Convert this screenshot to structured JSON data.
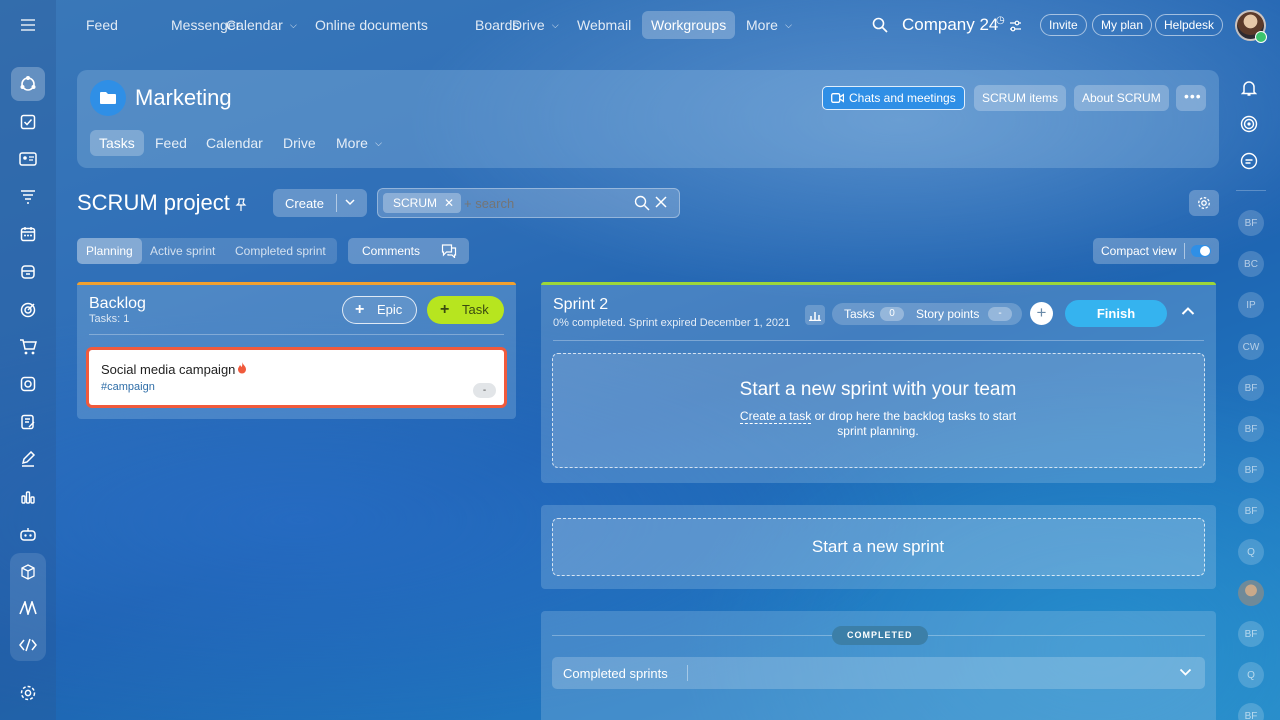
{
  "topnav": {
    "items": [
      "Feed",
      "Messenger",
      "Calendar",
      "Online documents",
      "Boards",
      "Drive",
      "Webmail",
      "Workgroups",
      "More"
    ],
    "company": "Company 24",
    "invite": "Invite",
    "my_plan": "My plan",
    "helpdesk": "Helpdesk"
  },
  "group": {
    "title": "Marketing",
    "tabs": [
      "Tasks",
      "Feed",
      "Calendar",
      "Drive",
      "More"
    ],
    "chats_btn": "Chats and meetings",
    "scrum_items_btn": "SCRUM items",
    "about_scrum_btn": "About SCRUM"
  },
  "project": {
    "title": "SCRUM project",
    "create": "Create",
    "filter_tag": "SCRUM",
    "search_placeholder": "+ search"
  },
  "views": {
    "planning": "Planning",
    "active_sprint": "Active sprint",
    "completed_sprint": "Completed sprint",
    "comments": "Comments",
    "compact_view": "Compact view"
  },
  "backlog": {
    "title": "Backlog",
    "count": "Tasks: 1",
    "epic_btn": "Epic",
    "task_btn": "Task",
    "task": {
      "name": "Social media campaign",
      "tag": "#campaign",
      "points": "-"
    }
  },
  "sprint": {
    "title": "Sprint 2",
    "status": "0% completed. Sprint expired December 1, 2021",
    "tasks_label": "Tasks",
    "tasks_count": "0",
    "sp_label": "Story points",
    "sp_value": "-",
    "finish_btn": "Finish",
    "empty_title": "Start a new sprint with your team",
    "empty_link": "Create a task",
    "empty_text1": " or drop here the backlog tasks to start",
    "empty_text2": "sprint planning."
  },
  "new_sprint": "Start a new sprint",
  "completed": {
    "badge": "COMPLETED",
    "label": "Completed sprints"
  },
  "right_rail": [
    "BF",
    "BC",
    "IP",
    "CW",
    "BF",
    "BF",
    "BF",
    "BF",
    "Q",
    "",
    "BF",
    "Q",
    "BF"
  ],
  "colors": {
    "accent_blue": "#2f8fe6",
    "task_green": "#b7e51f",
    "finish_blue": "#35b3ef",
    "backlog_bar": "#f0a030",
    "sprint_bar": "#9cd63a",
    "task_border": "#f05a3c"
  }
}
